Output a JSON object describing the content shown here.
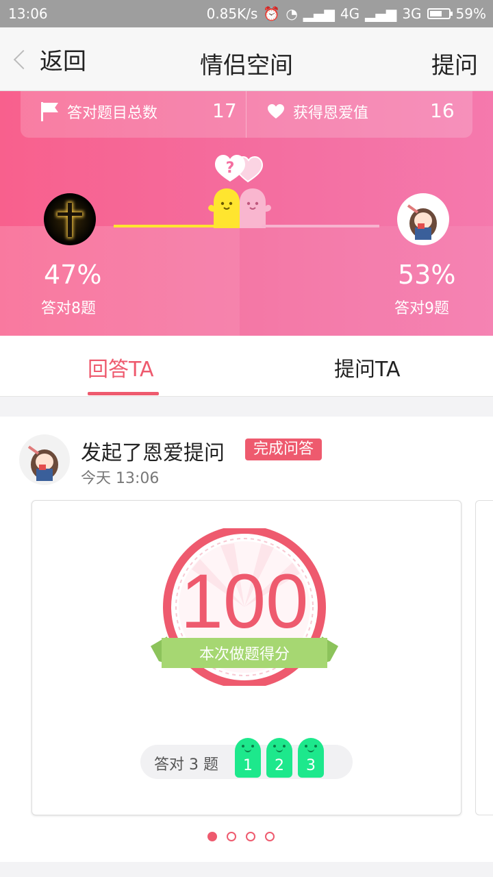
{
  "status_bar": {
    "time": "13:06",
    "net_speed": "0.85K/s",
    "net4g": "4G",
    "net3g": "3G",
    "battery": "59%",
    "battery_level": 0.59
  },
  "nav": {
    "back_label": "返回",
    "title": "情侣空间",
    "ask_label": "提问"
  },
  "stats": {
    "correct_total_label": "答对题目总数",
    "correct_total_value": "17",
    "love_label": "获得恩爱值",
    "love_value": "16"
  },
  "compare": {
    "left_percent": "47%",
    "left_sub": "答对8题",
    "right_percent": "53%",
    "right_sub": "答对9题",
    "question_mark": "?"
  },
  "tabs": [
    {
      "label": "回答TA"
    },
    {
      "label": "提问TA"
    }
  ],
  "feed": {
    "title": "发起了恩爱提问",
    "badge": "完成问答",
    "time": "今天 13:06",
    "score": "100",
    "score_caption": "本次做题得分",
    "answered_label": "答对 3 题",
    "tokens": [
      "1",
      "2",
      "3"
    ]
  },
  "colors": {
    "accent": "#ee5a6e",
    "hero_pink": "#f46ea0",
    "token_green": "#1de88c",
    "ribbon_green": "#a6d772"
  }
}
